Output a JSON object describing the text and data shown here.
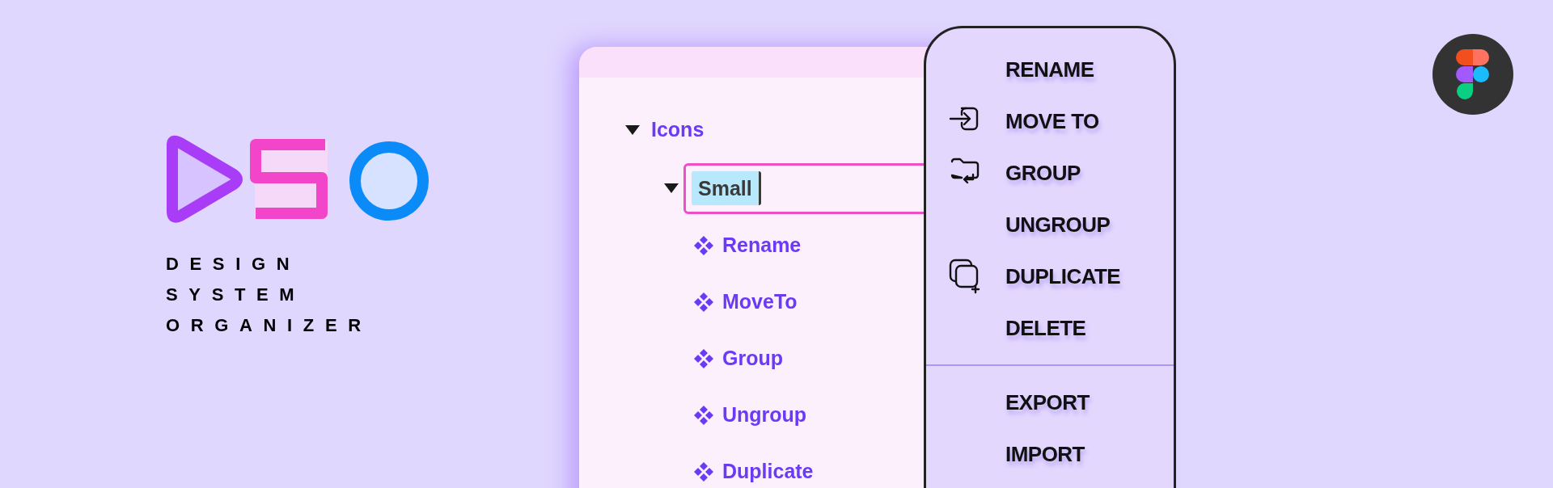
{
  "brand": {
    "lines": [
      "DESIGN",
      "SYSTEM",
      "ORGANIZER"
    ]
  },
  "tree": [
    {
      "label": "Icons",
      "expanded": true,
      "editing": false,
      "children": [
        {
          "label": "Small",
          "expanded": true,
          "editing": true,
          "children": [
            {
              "label": "Rename"
            },
            {
              "label": "MoveTo"
            },
            {
              "label": "Group"
            },
            {
              "label": "Ungroup"
            },
            {
              "label": "Duplicate"
            }
          ]
        }
      ]
    }
  ],
  "context_menu": {
    "sections": [
      [
        {
          "label": "RENAME",
          "kind": "plain"
        },
        {
          "label": "MOVE TO",
          "kind": "move"
        },
        {
          "label": "GROUP",
          "kind": "group"
        },
        {
          "label": "UNGROUP",
          "kind": "plain"
        },
        {
          "label": "DUPLICATE",
          "kind": "duplicate"
        },
        {
          "label": "DELETE",
          "kind": "plain"
        }
      ],
      [
        {
          "label": "EXPORT",
          "kind": "plain"
        },
        {
          "label": "IMPORT",
          "kind": "plain"
        }
      ]
    ]
  }
}
